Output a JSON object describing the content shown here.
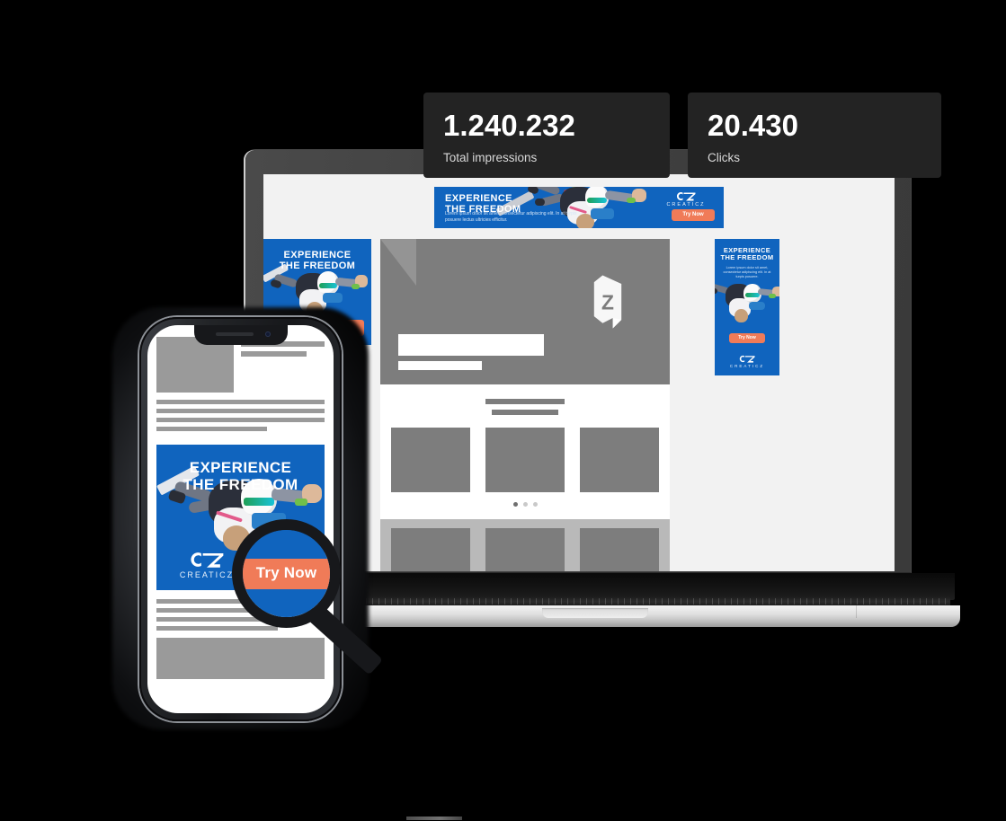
{
  "stats": [
    {
      "id": "total-impressions",
      "value": "1.240.232",
      "label": "Total impressions"
    },
    {
      "id": "clicks",
      "value": "20.430",
      "label": "Clicks"
    }
  ],
  "brand": {
    "name": "CREATICZ",
    "monogram": "CZ",
    "colors": {
      "ad_blue": "#1064be",
      "cta_orange": "#f07b58",
      "card_dark": "#232323",
      "wireframe_gray": "#7d7d7d"
    }
  },
  "ads": {
    "headline_line1": "EXPERIENCE",
    "headline_line2": "THE FREEDOM",
    "body_line1": "Lorem ipsum dolor sit amet, consectetur adipiscing elit.",
    "body_line2": "In at turpis posuere lectus ultricies efficitur.",
    "cta": "Try Now",
    "leaderboard": {
      "name": "leaderboard-banner",
      "headline_line1": "EXPERIENCE",
      "headline_line2": "THE FREEDOM",
      "cta": "Try Now"
    },
    "rectangle": {
      "name": "rectangle-banner",
      "headline_line1": "EXPERIENCE",
      "headline_line2": "THE FREEDOM",
      "cta": "Try Now"
    },
    "skyscraper": {
      "name": "skyscraper-banner",
      "headline_line1": "EXPERIENCE",
      "headline_line2": "THE FREEDOM",
      "body": "Lorem ipsum dolor sit amet, consectetur adipiscing elit. In at turpis posuere.",
      "cta": "Try Now"
    },
    "mobile": {
      "name": "mobile-banner",
      "headline_line1": "EXPERIENCE",
      "headline_line2": "THE FREEDOM",
      "cta": "Try Now"
    }
  },
  "magnifier": {
    "name": "magnifier-loupe",
    "magnified_label": "Try Now"
  },
  "laptop_page": {
    "hero_logo_letter": "Z",
    "carousel_dots": [
      true,
      false,
      false
    ],
    "card_count": 3
  },
  "icons": {
    "magnifier": "magnifier-icon",
    "z_logo": "z-bookmark-icon",
    "phone_camera": "front-camera-icon",
    "phone_speaker": "earpiece-speaker-icon"
  }
}
